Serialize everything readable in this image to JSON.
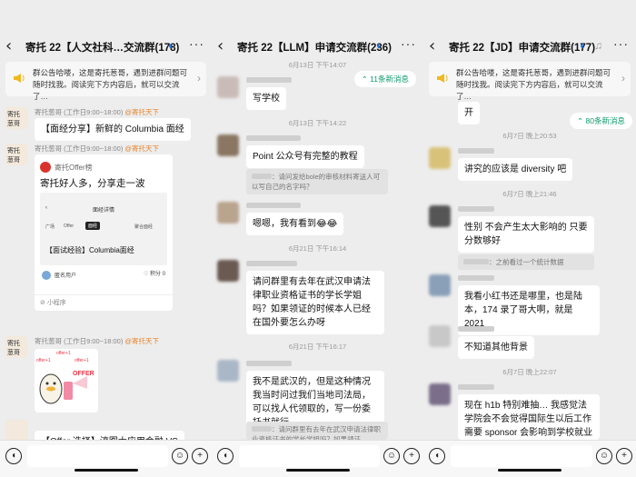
{
  "colors": {
    "bg": "#ededed",
    "accent_green": "#0c9a6a",
    "tag_orange": "#e8842c",
    "notice_icon": "#f1b81f"
  },
  "panel1": {
    "title": "寄托 22【人文社科…交流群(178)",
    "notice": "群公告哈喽，这是寄托葱哥，遇到进群问题可随时找我。阅读完下方内容后，就可以交流了…",
    "sender1": "寄托葱哥 (工作日9:00~18:00)",
    "sender_tag": "@寄托天下",
    "msg1": "【面经分享】新鲜的 Columbia 面经",
    "card": {
      "brand": "寄托Offer榜",
      "headline": "寄托好人多，分享走一波",
      "mini_title": "面经详情",
      "mini_tabs": [
        "广场",
        "Offer",
        "面经",
        "聚合面经"
      ],
      "article": "【面试经验】Columbia面经",
      "user": "匿名用户",
      "points": "积分 0",
      "footer": "小程序"
    },
    "sticker_text": [
      "offer+1",
      "offer+1",
      "offer+1",
      "OFFER"
    ],
    "msg_last": "【Offer 选择】流图大应用金融 VS"
  },
  "panel2": {
    "title": "寄托 22【LLM】申请交流群(236)",
    "new_count": "11条新消息",
    "t1": "6月13日 下午14:07",
    "m1": "写学校",
    "t2": "6月13日 下午14:22",
    "m2": "Point 公众号有完整的教程",
    "q2": "：请问发给bole的审核材料寄送人可以写自己的名字吗？",
    "m3": "嗯嗯，我有看到😂😂",
    "t3": "6月21日 下午16:14",
    "m4": "请问群里有去年在武汉申请法律职业资格证书的学长学姐吗？如果领证的时候本人已经在国外要怎么办呀",
    "t4": "6月21日 下午16:17",
    "m5": "我不是武汉的，但是这种情况我当时问过我们当地司法局，可以找人代领取的，写一份委托书就行",
    "q5": "：请问群里有去年在武汉申请法律职业资格证书的学长学姐吗？如果领证…"
  },
  "panel3": {
    "title": "寄托 22【JD】申请交流群(177)",
    "notice": "群公告哈喽，这是寄托葱哥，遇到进群问题可随时找我。阅读完下方内容后，就可以交流了…",
    "new_count": "80条新消息",
    "m0": "开",
    "t1": "6月7日 晚上20:53",
    "m1": "讲究的应该是 diversity 吧",
    "t2": "6月7日 晚上21:46",
    "m2": "性别 不会产生太大影响的 只要分数够好",
    "q2": "：之前看过一个统计数据",
    "m3": "我看小红书还是哪里，也是陆本，174 录了哥大啊，就是 2021",
    "m4": "不知道其他背景",
    "t3": "6月7日 晚上22:07",
    "m5": "现在 h1b 特别难抽… 我感觉法学院会不会觉得国际生以后工作需要 sponsor 会影响到学校就业报告"
  }
}
